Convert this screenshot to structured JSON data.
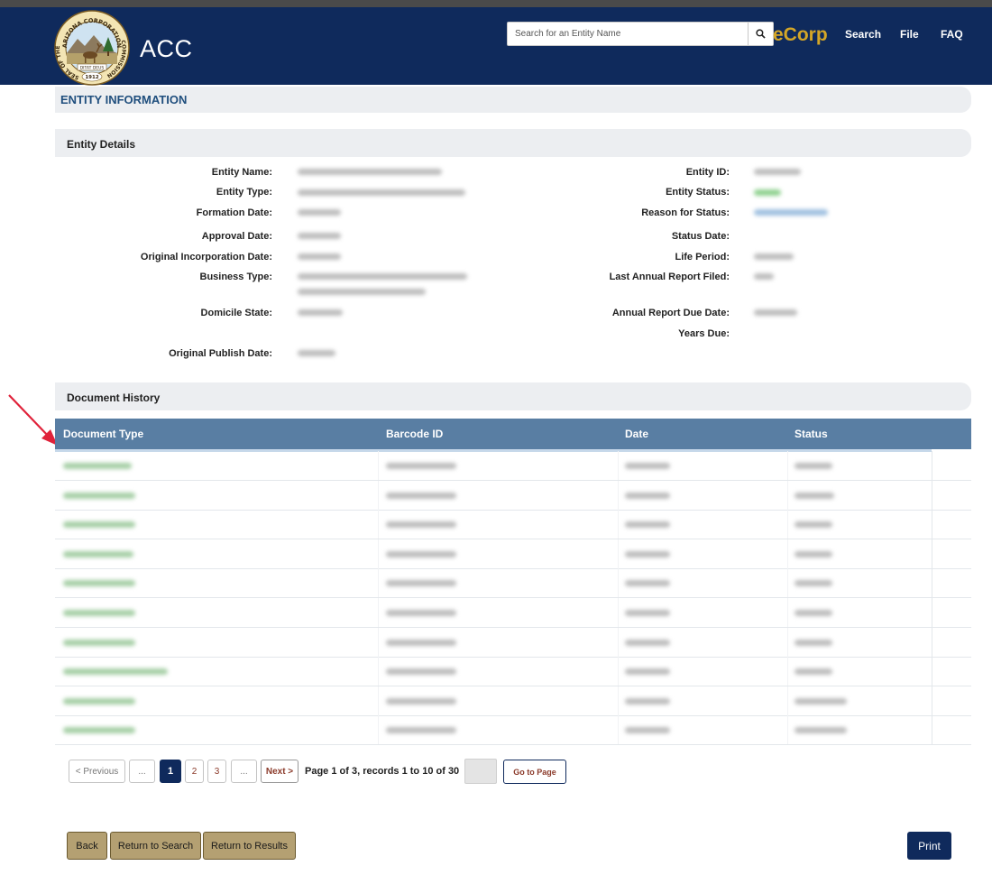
{
  "header": {
    "brand": "ACC",
    "seal": {
      "top_text": "ARIZONA CORPORATION",
      "left_text": "SEAL OF THE",
      "right_text": "COMMISSION",
      "motto": "DITAT DEUS",
      "year": "1912"
    },
    "search_placeholder": "Search for an Entity Name",
    "search_icon": "search-icon",
    "ecorp": "eCorp",
    "nav": [
      "Search",
      "File",
      "FAQ"
    ]
  },
  "entity_info_title": "ENTITY INFORMATION",
  "entity_details": {
    "title": "Entity Details",
    "left_labels": [
      "Entity Name:",
      "Entity Type:",
      "Formation Date:",
      "Approval Date:",
      "Original Incorporation Date:",
      "Business Type:",
      "Domicile State:",
      "Original Publish Date:"
    ],
    "right_labels": [
      "Entity ID:",
      "Entity Status:",
      "Reason for Status:",
      "Status Date:",
      "Life Period:",
      "Last Annual Report Filed:",
      "Annual Report Due Date:",
      "Years Due:"
    ]
  },
  "document_history": {
    "title": "Document History",
    "columns": [
      "Document Type",
      "Barcode ID",
      "Date",
      "Status"
    ]
  },
  "pagination": {
    "previous": "< Previous",
    "ellipsis": "...",
    "pages": [
      "1",
      "2",
      "3"
    ],
    "current_page": "1",
    "next": "Next >",
    "info": "Page 1 of 3, records 1 to 10 of 30",
    "go_to_page": "Go to Page"
  },
  "buttons": {
    "back": "Back",
    "return_to_search": "Return to Search",
    "return_to_results": "Return to Results",
    "print": "Print"
  },
  "colors": {
    "header_bg": "#0f2a5c",
    "ecorp_gold": "#d4a627",
    "table_header": "#597ea3",
    "action_gold": "#b4a072",
    "annotation_arrow": "#e0223a"
  }
}
